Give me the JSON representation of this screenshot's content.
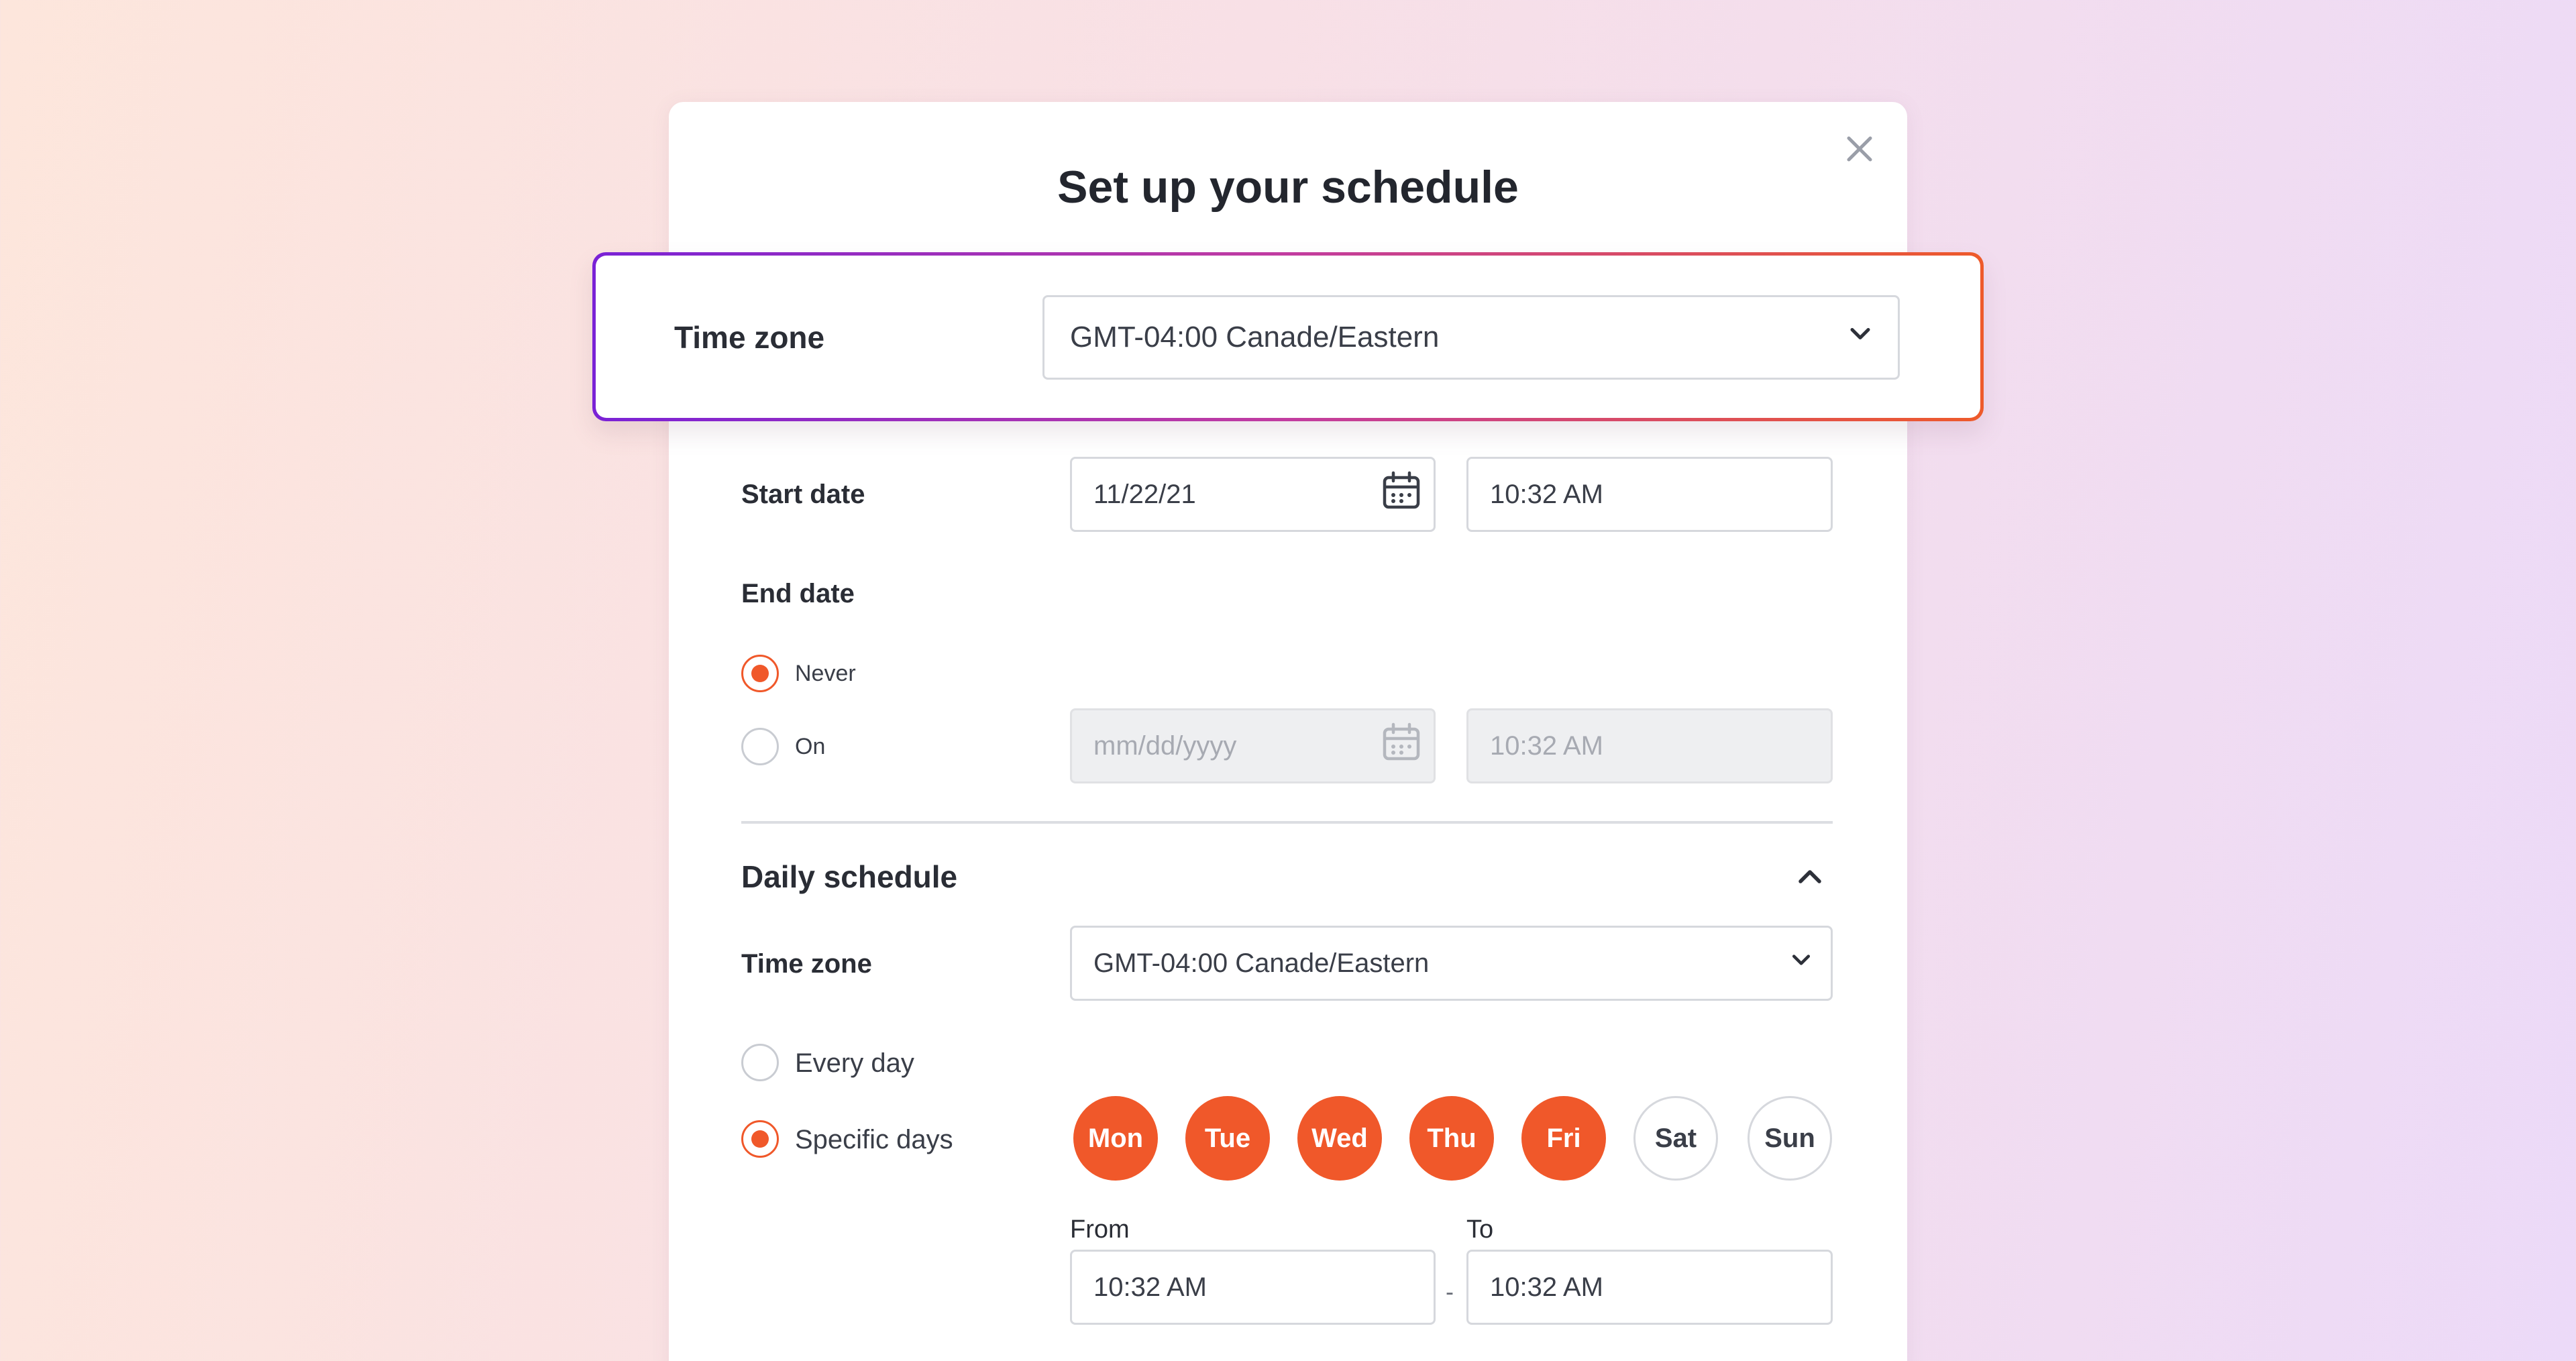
{
  "modal": {
    "title": "Set up your schedule"
  },
  "highlight": {
    "label": "Time zone",
    "value": "GMT-04:00 Canade/Eastern"
  },
  "start_date": {
    "label": "Start date",
    "date_value": "11/22/21",
    "time_value": "10:32 AM"
  },
  "end_date": {
    "label": "End date",
    "never_label": "Never",
    "on_label": "On",
    "date_placeholder": "mm/dd/yyyy",
    "time_value": "10:32 AM",
    "selected": "never"
  },
  "daily": {
    "heading": "Daily schedule",
    "tz_label": "Time zone",
    "tz_value": "GMT-04:00 Canade/Eastern",
    "every_day_label": "Every day",
    "specific_days_label": "Specific days",
    "selected": "specific",
    "days": [
      {
        "label": "Mon",
        "selected": true
      },
      {
        "label": "Tue",
        "selected": true
      },
      {
        "label": "Wed",
        "selected": true
      },
      {
        "label": "Thu",
        "selected": true
      },
      {
        "label": "Fri",
        "selected": true
      },
      {
        "label": "Sat",
        "selected": false
      },
      {
        "label": "Sun",
        "selected": false
      }
    ],
    "from_label": "From",
    "to_label": "To",
    "from_value": "10:32 AM",
    "to_value": "10:32 AM",
    "separator": "-"
  },
  "colors": {
    "accent": "#f0582a",
    "gradient_start": "#7a22d6",
    "gradient_end": "#ee5a2a"
  },
  "icons": {
    "close": "close-icon",
    "chevron_down": "chevron-down-icon",
    "chevron_up": "chevron-up-icon",
    "calendar": "calendar-icon"
  }
}
